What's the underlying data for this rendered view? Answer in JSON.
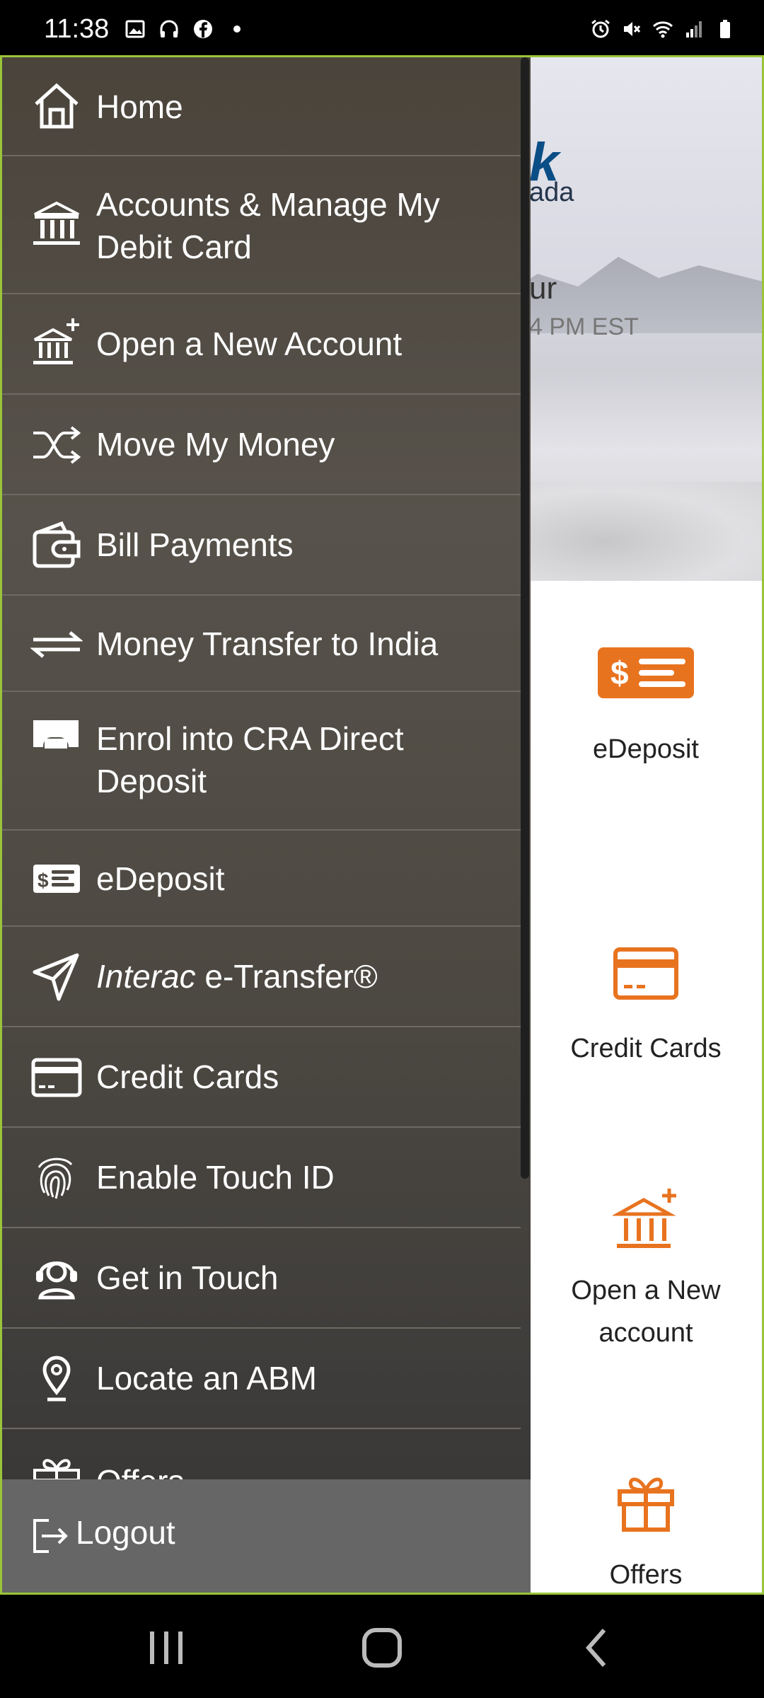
{
  "status_bar": {
    "time": "11:38",
    "left_icons": [
      "image-icon",
      "headphones-icon",
      "facebook-icon",
      "dot-icon"
    ],
    "right_icons": [
      "alarm-icon",
      "mute-icon",
      "wifi-icon",
      "signal-icon",
      "battery-icon"
    ]
  },
  "background_app": {
    "brand_partial_1": "k",
    "brand_partial_2": "ada",
    "hero_partial_1": "ur",
    "hero_partial_2": "4 PM EST",
    "tiles": [
      {
        "label": "eDeposit",
        "icon": "edeposit-icon"
      },
      {
        "label": "Credit Cards",
        "icon": "credit-card-icon"
      },
      {
        "label_line1": "Open a New",
        "label_line2": "account",
        "icon": "bank-plus-icon"
      },
      {
        "label": "Offers",
        "icon": "gift-icon"
      }
    ],
    "accent_color": "#e8731f"
  },
  "drawer": {
    "items": [
      {
        "label": "Home",
        "icon": "home-icon"
      },
      {
        "label_line1": "Accounts & Manage My",
        "label_line2": "Debit Card",
        "icon": "bank-icon"
      },
      {
        "label": "Open a New Account",
        "icon": "bank-plus-icon"
      },
      {
        "label": "Move My Money",
        "icon": "shuffle-icon"
      },
      {
        "label": "Bill Payments",
        "icon": "wallet-icon"
      },
      {
        "label": "Money Transfer to India",
        "icon": "transfer-arrows-icon"
      },
      {
        "label_line1": "Enrol into CRA Direct",
        "label_line2": "Deposit",
        "icon": "direct-deposit-icon"
      },
      {
        "label": "eDeposit",
        "icon": "edeposit-icon"
      },
      {
        "label_italic": "Interac",
        "label_rest": " e-Transfer®",
        "icon": "send-icon"
      },
      {
        "label": "Credit Cards",
        "icon": "credit-card-icon"
      },
      {
        "label": "Enable Touch ID",
        "icon": "fingerprint-icon"
      },
      {
        "label": "Get in Touch",
        "icon": "support-agent-icon"
      },
      {
        "label": "Locate an ABM",
        "icon": "location-pin-icon"
      },
      {
        "label": "Offers",
        "icon": "gift-icon"
      }
    ],
    "logout": {
      "label": "Logout",
      "icon": "logout-icon"
    }
  },
  "nav_bar": {
    "buttons": [
      "recents-icon",
      "home-circle-icon",
      "back-icon"
    ]
  }
}
